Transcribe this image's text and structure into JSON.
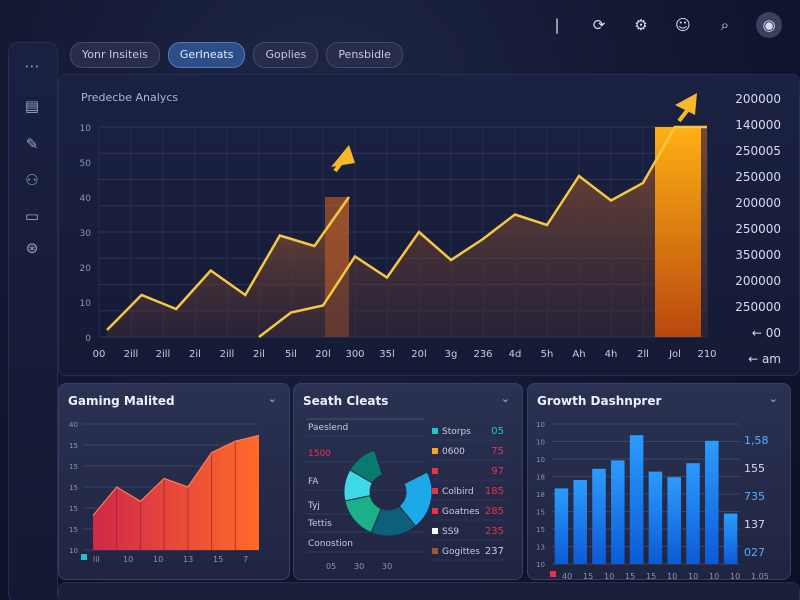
{
  "tabs": [
    "Yonr Insiteis",
    "GerIneats",
    "Goplies",
    "Pensbidle"
  ],
  "icons": {
    "top": [
      "separator-icon",
      "refresh-icon",
      "gear-icon",
      "chat-icon",
      "search-icon",
      "avatar"
    ],
    "sidebar": [
      "grid-icon",
      "document-icon",
      "edit-icon",
      "users-icon",
      "card-icon",
      "settings-icon"
    ]
  },
  "colors": {
    "accent_orange": "#f0a020",
    "line_yellow": "#f5c842",
    "bar_blue": "#1e90ff",
    "red": "#e8334a",
    "teal": "#22c3c9"
  },
  "main": {
    "title": "Predecbe Analycs"
  },
  "chart_data": [
    {
      "type": "area",
      "title": "Predecbe Analycs",
      "x": [
        "00",
        "2ill",
        "2ill",
        "2il",
        "2ill",
        "2il",
        "5il",
        "20l",
        "300",
        "35l",
        "20l",
        "3g",
        "236",
        "4d",
        "5h",
        "Ah",
        "4h",
        "2ll",
        "Jol",
        "210"
      ],
      "y_left_ticks": [
        "0",
        "10",
        "20",
        "30",
        "40",
        "50",
        "10"
      ],
      "y_right_ticks": [
        "200000",
        "140000",
        "250005",
        "250000",
        "200000",
        "250000",
        "350000",
        "200000",
        "250000",
        "← 00",
        "← am"
      ],
      "series": [
        {
          "values": [
            2,
            12,
            8,
            19,
            12,
            29,
            26,
            40
          ]
        },
        {
          "values": [
            0,
            7,
            9,
            23,
            17,
            30,
            22,
            28,
            35,
            32,
            46,
            39,
            44,
            60,
            60
          ]
        }
      ]
    },
    {
      "type": "area",
      "title": "Gaming Malited",
      "y_ticks": [
        "40",
        "15",
        "15",
        "15",
        "15",
        "15",
        "10"
      ],
      "x_ticks": [
        "lil",
        "10",
        "10",
        "13",
        "15",
        "7"
      ],
      "values": [
        12,
        22,
        17,
        25,
        22,
        34,
        38,
        40
      ]
    },
    {
      "type": "pie",
      "title": "Seath Cleats",
      "labels_left": [
        "Paeslend",
        "1500",
        "FA",
        "Tyj",
        "Tettis",
        "Conostion"
      ],
      "legend": [
        {
          "label": "Storps",
          "value": "05",
          "color": "#22c3c9"
        },
        {
          "label": "0600",
          "value": "75",
          "color": "#f5a623"
        },
        {
          "label": "",
          "value": "97",
          "color": "#e8334a"
        },
        {
          "label": "Colbird",
          "value": "185",
          "color": "#e8334a"
        },
        {
          "label": "Goatnes",
          "value": "285",
          "color": "#e8334a"
        },
        {
          "label": "SS9",
          "value": "235",
          "color": "#ffffff"
        },
        {
          "label": "Gogittes",
          "value": "237",
          "color": "#9a5a3a"
        }
      ],
      "x_ticks": [
        "05",
        "30",
        "30"
      ],
      "slices": [
        {
          "value": 28,
          "color": "#1da8e8"
        },
        {
          "value": 22,
          "color": "#0e5f7a"
        },
        {
          "value": 20,
          "color": "#19b08a"
        },
        {
          "value": 15,
          "color": "#3fd8e8"
        },
        {
          "value": 15,
          "color": "#0b7a6e"
        }
      ]
    },
    {
      "type": "bar",
      "title": "Growth Dashnprer",
      "y_left_ticks": [
        "10",
        "10",
        "10",
        "18",
        "18",
        "15",
        "15",
        "13",
        "10"
      ],
      "y_right_ticks": [
        "1,58",
        "155",
        "735",
        "137",
        "027"
      ],
      "x_ticks": [
        "40",
        "15",
        "10",
        "15",
        "15",
        "10",
        "10",
        "10",
        "10",
        "1.05"
      ],
      "values": [
        54,
        60,
        68,
        74,
        92,
        66,
        62,
        72,
        88,
        36
      ]
    }
  ]
}
